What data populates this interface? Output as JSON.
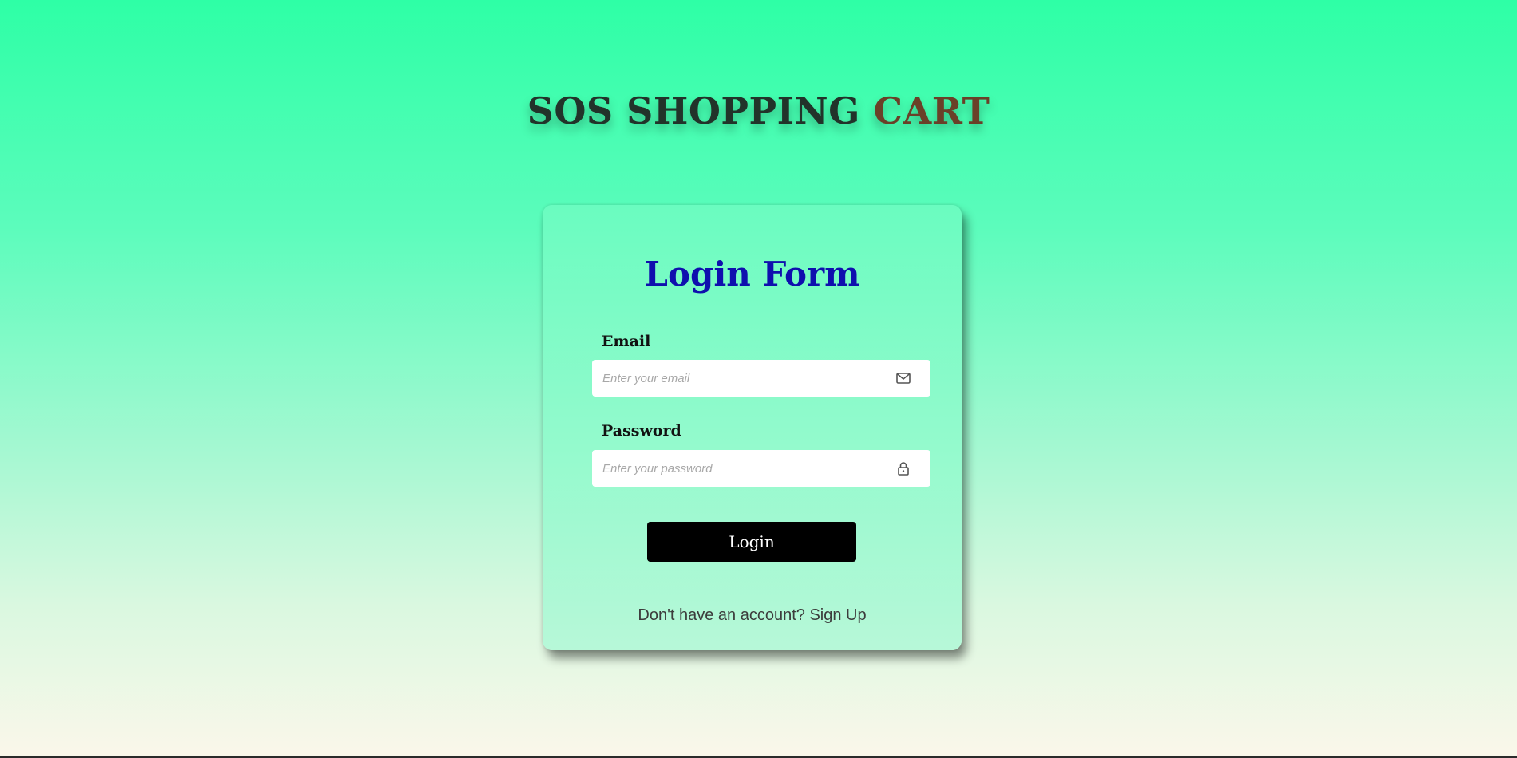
{
  "brand": {
    "part1": "SOS SHOPPING",
    "part2": "CART"
  },
  "login_form": {
    "title": "Login Form",
    "email": {
      "label": "Email",
      "placeholder": "Enter your email",
      "value": "",
      "icon": "mail-icon"
    },
    "password": {
      "label": "Password",
      "placeholder": "Enter your password",
      "value": "",
      "icon": "lock-icon"
    },
    "submit_label": "Login",
    "signup_prompt": "Don't have an account?",
    "signup_link": "Sign Up"
  },
  "colors": {
    "title": "#0f0fae",
    "button_bg": "#000000",
    "brand_dark": "#22332a",
    "brand_accent": "#6a4028"
  }
}
